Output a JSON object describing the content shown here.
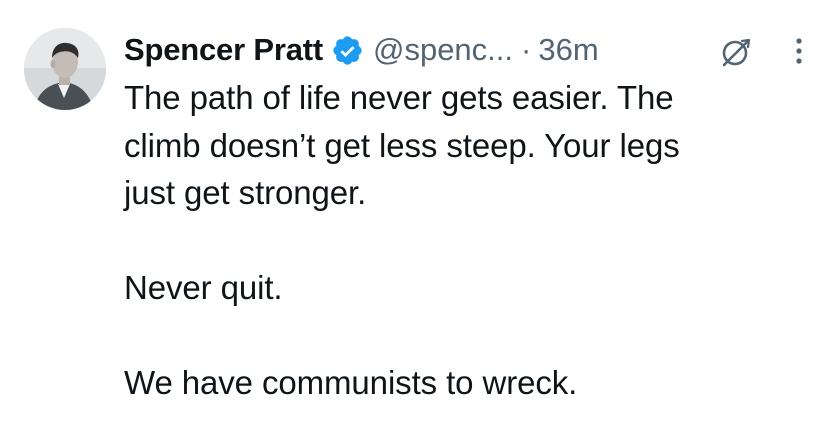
{
  "tweet": {
    "author": {
      "display_name": "Spencer Pratt",
      "handle": "@spenc...",
      "verified": true,
      "avatar_icon": "profile-photo"
    },
    "separator": "·",
    "timestamp": "36m",
    "icons": {
      "grok": "grok-icon",
      "more": "more-options-icon",
      "verified": "verified-badge-icon"
    },
    "text": {
      "line1": "The path of life never gets easier. The",
      "line2": "climb doesn’t get less steep. Your legs",
      "line3": "just get stronger.",
      "line4": "Never quit.",
      "line5": "We have communists to wreck."
    },
    "colors": {
      "verified_blue": "#1d9bf0",
      "secondary_text": "#536471",
      "primary_text": "#0f1419"
    }
  }
}
